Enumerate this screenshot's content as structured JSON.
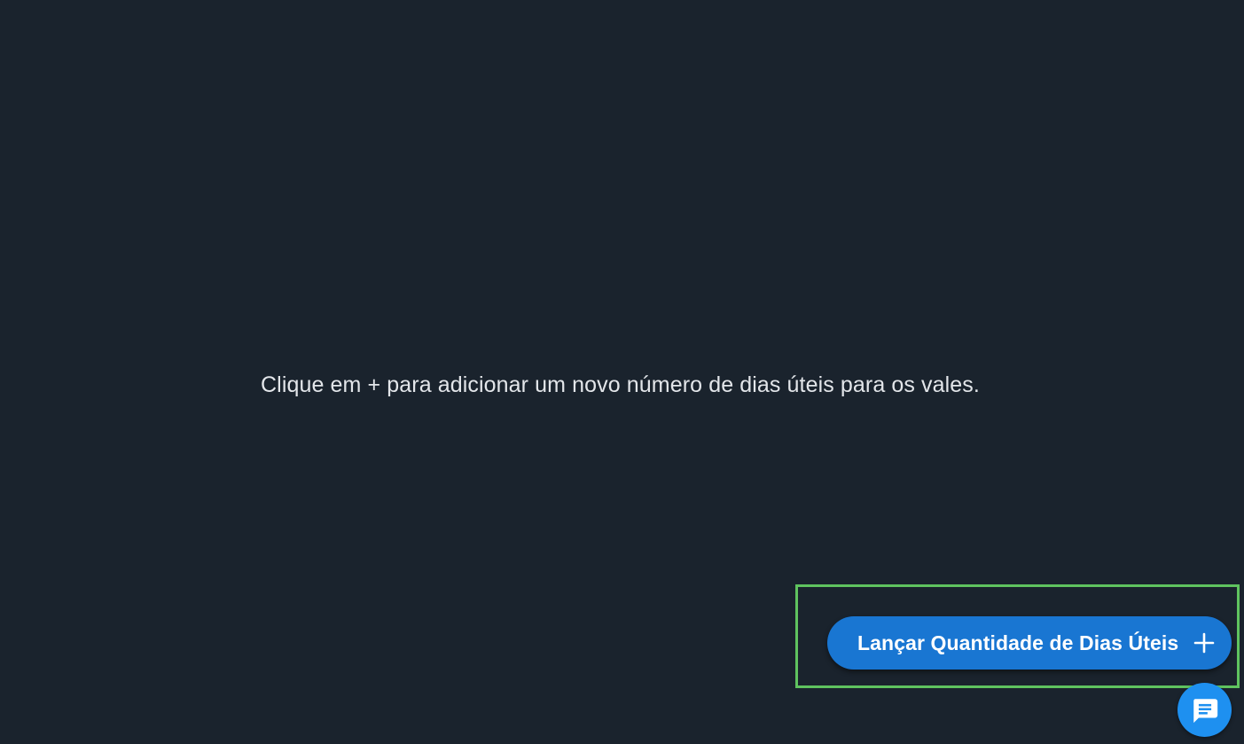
{
  "main": {
    "empty_message": "Clique em + para adicionar um novo número de dias úteis para os vales."
  },
  "fab": {
    "label": "Lançar Quantidade de Dias Úteis",
    "icon": "plus-icon"
  },
  "chat": {
    "icon": "chat-icon"
  },
  "colors": {
    "background": "#1a232d",
    "text": "#e3e6ea",
    "fab": "#1976d2",
    "chat": "#1e90f0",
    "highlight": "#5fc35f"
  }
}
